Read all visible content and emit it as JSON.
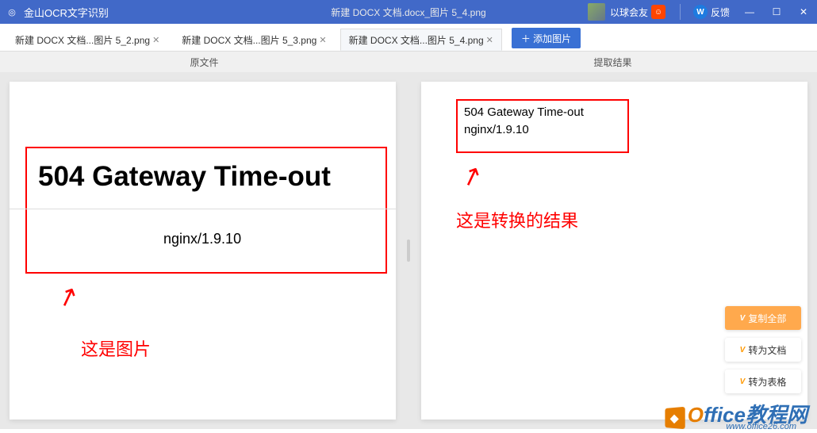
{
  "titlebar": {
    "app_name": "金山OCR文字识别",
    "doc_title": "新建 DOCX 文档.docx_图片 5_4.png",
    "user_label": "以球会友",
    "feedback_label": "反馈"
  },
  "tabs": [
    {
      "label": "新建 DOCX 文档...图片 5_2.png"
    },
    {
      "label": "新建 DOCX 文档...图片 5_3.png"
    },
    {
      "label": "新建 DOCX 文档...图片 5_4.png"
    }
  ],
  "add_image_label": "＋ 添加图片",
  "headers": {
    "left": "原文件",
    "right": "提取结果"
  },
  "left_panel": {
    "main_heading": "504 Gateway Time-out",
    "sub_heading": "nginx/1.9.10",
    "annotation": "这是图片"
  },
  "right_panel": {
    "line1": "504 Gateway Time-out",
    "line2": "nginx/1.9.10",
    "annotation": "这是转换的结果"
  },
  "actions": {
    "copy_all": "复制全部",
    "to_doc": "转为文档",
    "to_table": "转为表格"
  },
  "watermark": {
    "brand1": "O",
    "brand2": "ffice",
    "brand3": "教程网",
    "url": "www.office26.com"
  }
}
